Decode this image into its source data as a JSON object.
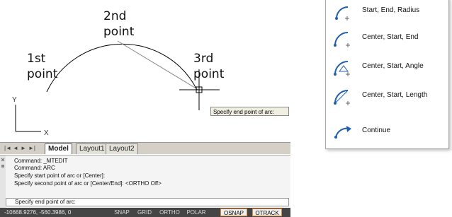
{
  "drawing": {
    "point_labels": {
      "p1": "1st\npoint",
      "p2": "2nd\npoint",
      "p3": "3rd\npoint"
    },
    "ucs_x_label": "X",
    "ucs_y_label": "Y",
    "tooltip": "Specify end point of arc:"
  },
  "layout_tabs": {
    "nav": [
      "|◄",
      "◄",
      "►",
      "►|"
    ],
    "tabs": [
      "Model",
      "Layout1",
      "Layout2"
    ],
    "active": "Model"
  },
  "command_window": {
    "history": [
      "Command: _MTEDIT",
      "Command: ARC",
      "Specify start point of arc or [Center]:",
      "Specify second point of arc or [Center/End]: <ORTHO Off>"
    ],
    "prompt": "Specify end point of arc:"
  },
  "status_bar": {
    "coordinates": "-10668.9276, -560.3986, 0",
    "toggles": [
      {
        "label": "SNAP",
        "on": false
      },
      {
        "label": "GRID",
        "on": false
      },
      {
        "label": "ORTHO",
        "on": false
      },
      {
        "label": "POLAR",
        "on": false
      },
      {
        "label": "OSNAP",
        "on": true
      },
      {
        "label": "OTRACK",
        "on": true
      }
    ]
  },
  "arc_menu": {
    "items": [
      {
        "label": "Start, End, Radius",
        "icon": "arc-start-end-radius-icon"
      },
      {
        "label": "Center, Start, End",
        "icon": "arc-center-start-end-icon"
      },
      {
        "label": "Center, Start, Angle",
        "icon": "arc-center-start-angle-icon"
      },
      {
        "label": "Center, Start, Length",
        "icon": "arc-center-start-length-icon"
      },
      {
        "label": "Continue",
        "icon": "arc-continue-icon"
      }
    ]
  },
  "colors": {
    "status_bg": "#454545",
    "toggle_on_border": "#e08a3a",
    "icon_blue": "#1f5fae"
  }
}
